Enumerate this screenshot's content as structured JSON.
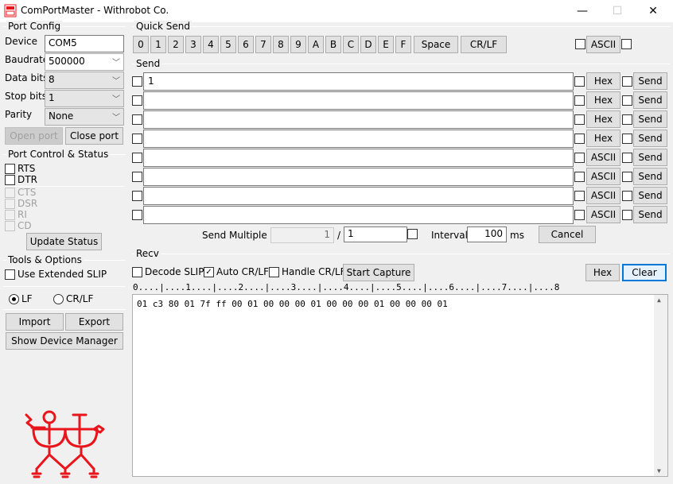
{
  "window": {
    "title": "ComPortMaster - Withrobot Co.",
    "minimize_glyph": "—",
    "maximize_glyph": "☐",
    "close_glyph": "✕"
  },
  "port_config": {
    "group_label": "Port Config",
    "device_label": "Device",
    "device_value": "COM5",
    "baudrate_label": "Baudrate",
    "baudrate_value": "500000",
    "databits_label": "Data bits",
    "databits_value": "8",
    "stopbits_label": "Stop bits",
    "stopbits_value": "1",
    "parity_label": "Parity",
    "parity_value": "None",
    "open_port_label": "Open port",
    "close_port_label": "Close port"
  },
  "port_control": {
    "group_label": "Port Control & Status",
    "lines": [
      "RTS",
      "DTR",
      "CTS",
      "DSR",
      "RI",
      "CD"
    ],
    "update_status_label": "Update Status"
  },
  "tools": {
    "group_label": "Tools & Options",
    "use_extended_slip_label": "Use Extended SLIP",
    "lf_label": "LF",
    "crlf_label": "CR/LF",
    "import_label": "Import",
    "export_label": "Export",
    "show_device_manager_label": "Show Device Manager"
  },
  "quick_send": {
    "group_label": "Quick Send",
    "keys": [
      "0",
      "1",
      "2",
      "3",
      "4",
      "5",
      "6",
      "7",
      "8",
      "9",
      "A",
      "B",
      "C",
      "D",
      "E",
      "F"
    ],
    "space_label": "Space",
    "crlf_label": "CR/LF",
    "ascii_label": "ASCII"
  },
  "send": {
    "group_label": "Send",
    "rows": [
      {
        "value": "1",
        "mode": "Hex",
        "send": "Send"
      },
      {
        "value": "",
        "mode": "Hex",
        "send": "Send"
      },
      {
        "value": "",
        "mode": "Hex",
        "send": "Send"
      },
      {
        "value": "",
        "mode": "Hex",
        "send": "Send"
      },
      {
        "value": "",
        "mode": "ASCII",
        "send": "Send"
      },
      {
        "value": "",
        "mode": "ASCII",
        "send": "Send"
      },
      {
        "value": "",
        "mode": "ASCII",
        "send": "Send"
      },
      {
        "value": "",
        "mode": "ASCII",
        "send": "Send"
      }
    ],
    "send_multiple_label": "Send Multiple :",
    "send_multiple_count": "1",
    "slash": "/",
    "send_multiple_total": "1",
    "interval_label": "Interval",
    "interval_value": "100",
    "interval_unit": "ms",
    "cancel_label": "Cancel"
  },
  "recv": {
    "group_label": "Recv",
    "decode_slip_label": "Decode SLIP",
    "auto_crlf_label": "Auto CR/LF",
    "handshake_crlf_label": "Handle CR/LF",
    "start_capture_label": "Start Capture",
    "hex_label": "Hex",
    "clear_label": "Clear",
    "ruler": "0....|....1....|....2....|....3....|....4....|....5....|....6....|....7....|....8",
    "text": "01 c3 80 01 7f ff 00 01 00 00 00 01 00 00 00 01 00 00 00 01",
    "scroll_up_glyph": "▲",
    "scroll_down_glyph": "▼"
  },
  "colors": {
    "logo_red": "#e8161c",
    "window_bg": "#f0f0f0",
    "focus_blue": "#0078d7"
  }
}
